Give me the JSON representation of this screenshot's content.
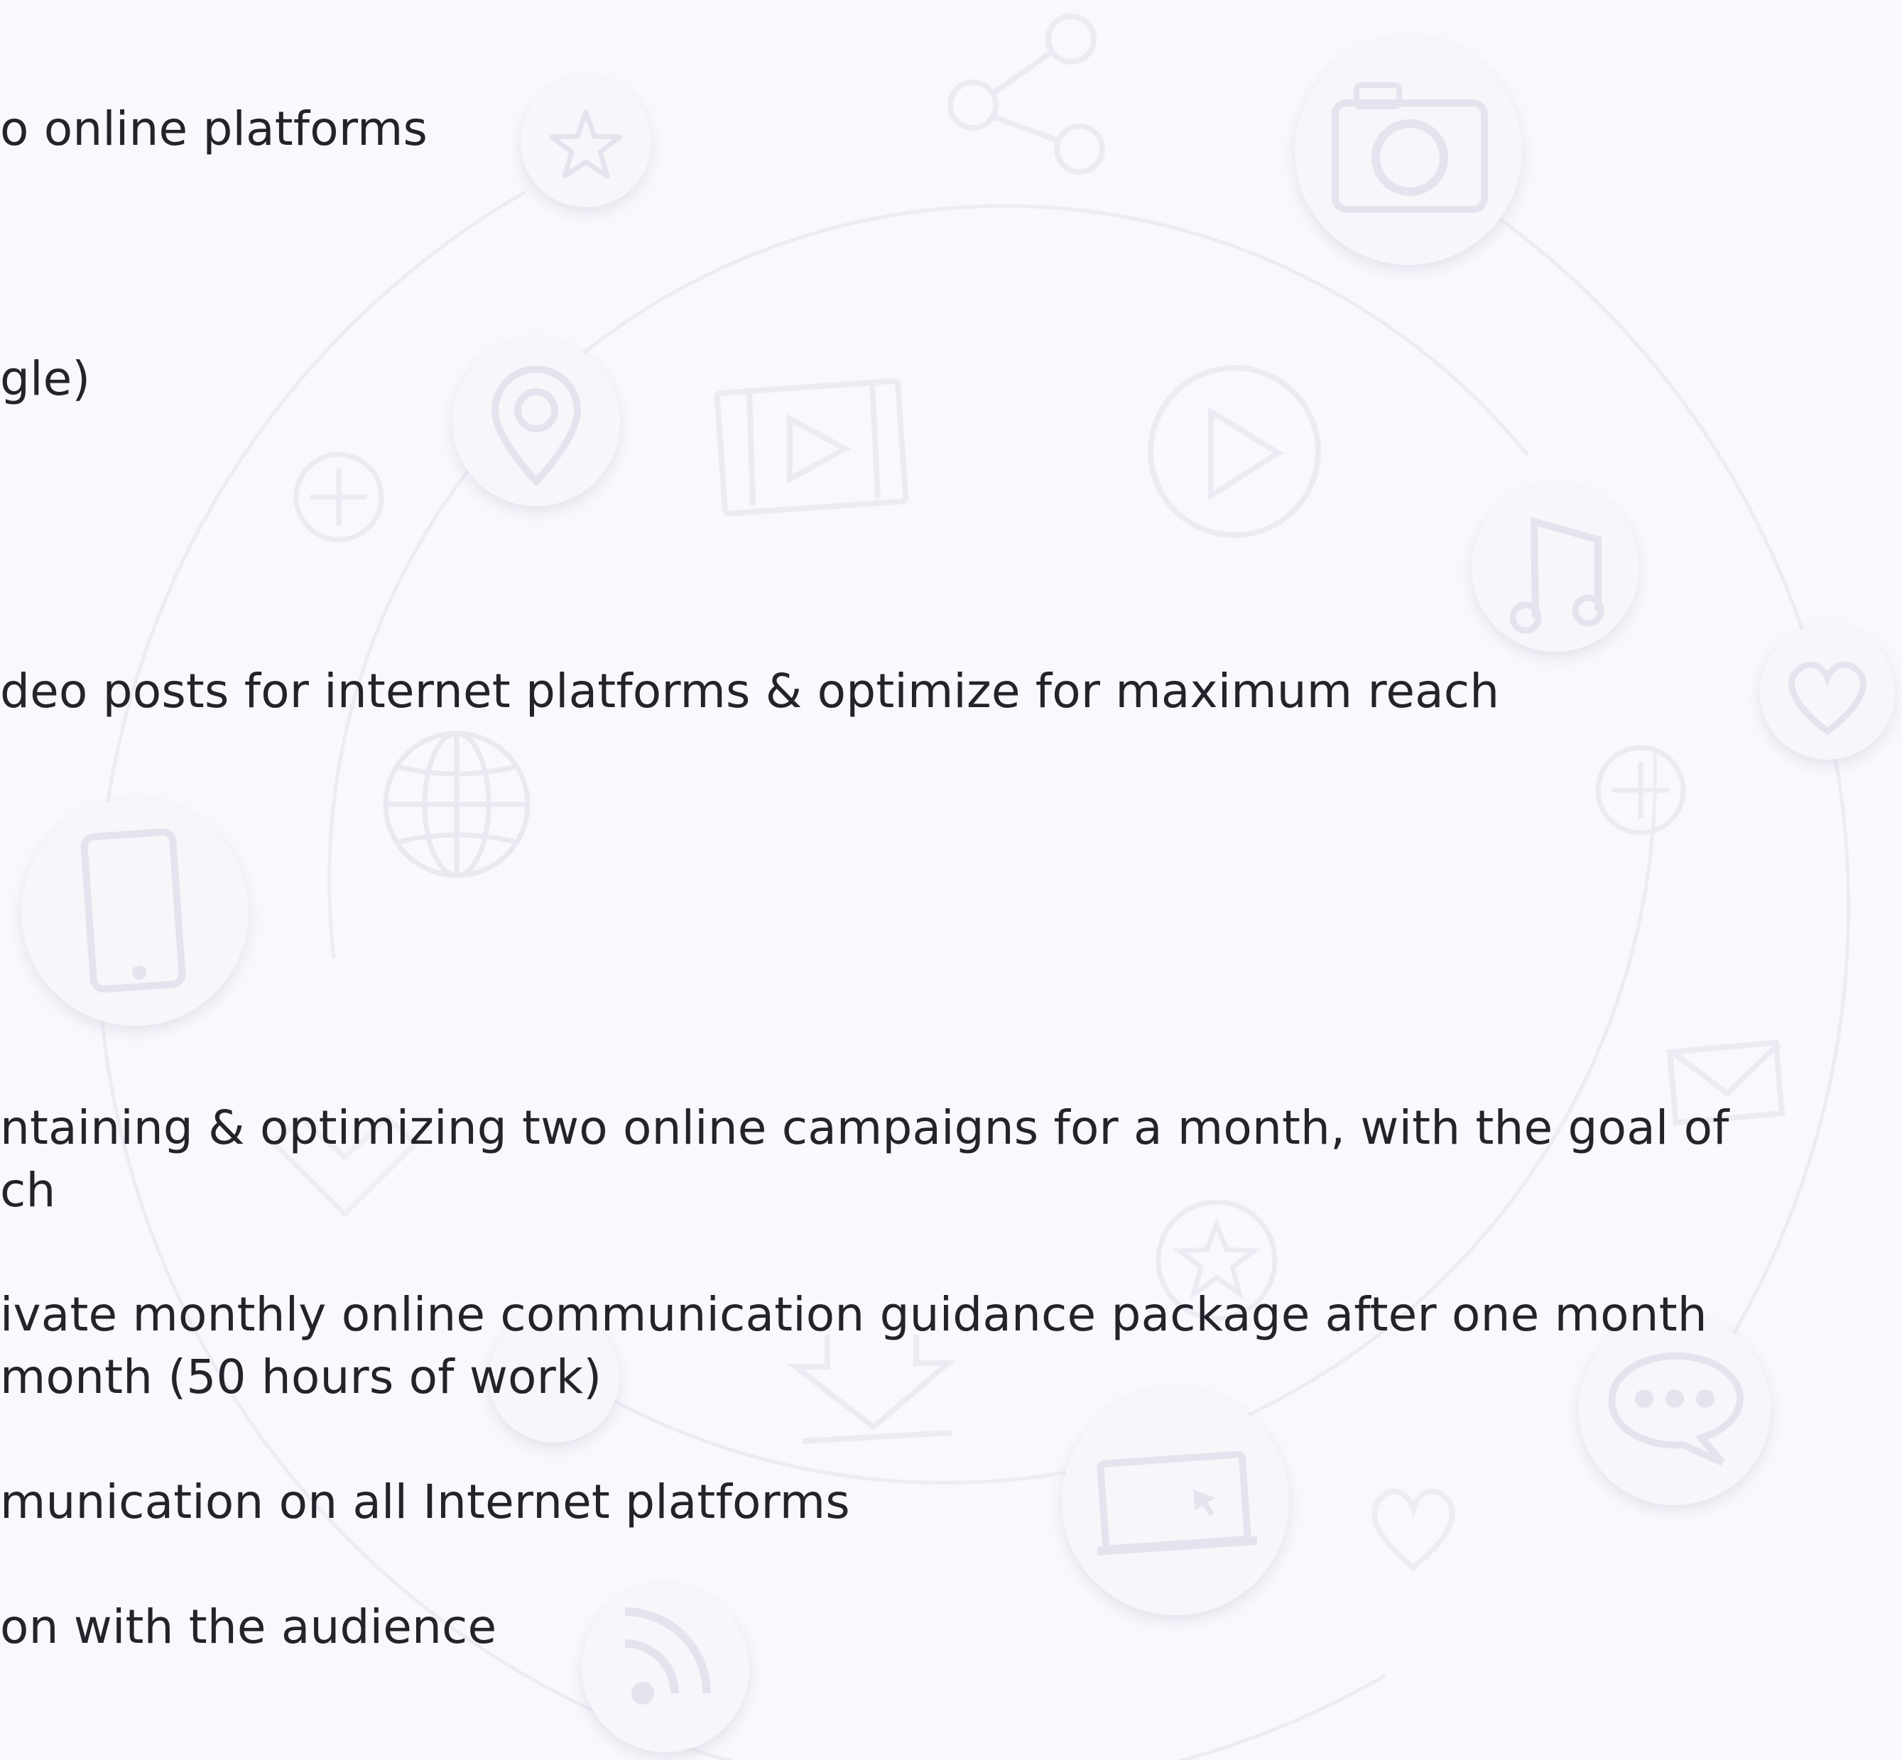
{
  "lines": [
    "o online platforms",
    "gle)",
    "deo posts for internet platforms & optimize for maximum reach",
    "ntaining & optimizing two online campaigns for a month, with the goal of",
    "ch",
    "ivate monthly online communication guidance package after one month",
    "month (50 hours of work)",
    "munication on all Internet platforms",
    "on with the audience"
  ],
  "colors": {
    "background": "#f8f8fd",
    "text": "#23232b",
    "decor_fill": "#f3f3f9",
    "decor_stroke": "#e6e6ee"
  },
  "icons": [
    "star-icon",
    "share-icon",
    "camera-icon",
    "location-pin-icon",
    "film-icon",
    "play-icon",
    "music-note-icon",
    "heart-icon",
    "plus-icon",
    "globe-icon",
    "smartphone-icon",
    "mail-icon",
    "chat-bubble-icon",
    "laptop-icon",
    "download-icon",
    "rss-icon"
  ]
}
